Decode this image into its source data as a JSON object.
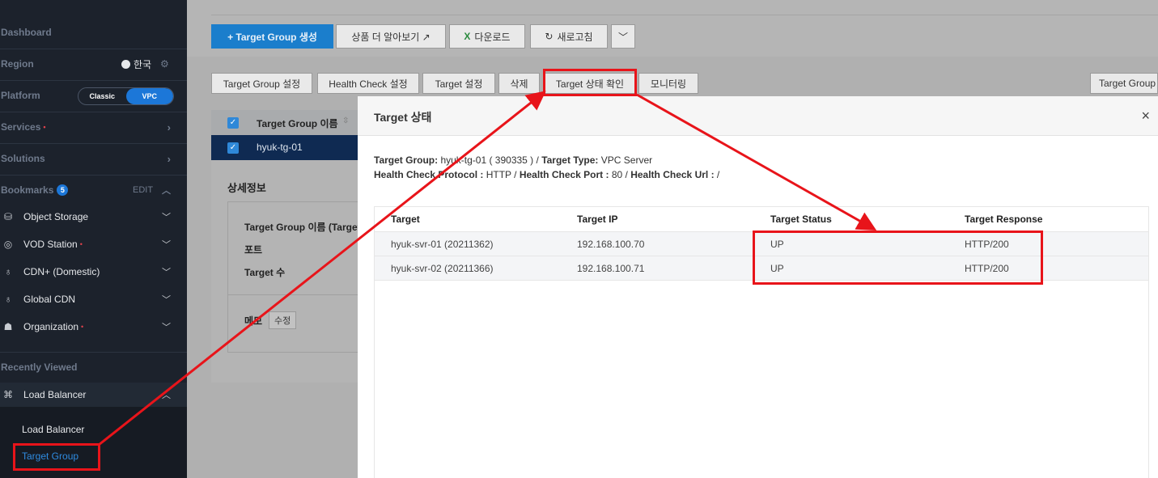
{
  "sidebar": {
    "dashboard": "Dashboard",
    "region": "Region",
    "region_value": "한국",
    "platform": "Platform",
    "platform_options": [
      "Classic",
      "VPC"
    ],
    "services": "Services",
    "solutions": "Solutions",
    "bookmarks": "Bookmarks",
    "bookmarks_count": "5",
    "bookmarks_edit": "EDIT",
    "bookmark_items": [
      "Object Storage",
      "VOD Station",
      "CDN+ (Domestic)",
      "Global CDN",
      "Organization"
    ],
    "recently_viewed": "Recently Viewed",
    "recent_group": "Load Balancer",
    "sub_items": [
      "Load Balancer",
      "Target Group"
    ],
    "required_mark": "•"
  },
  "toolbar": {
    "create": "+ Target Group 생성",
    "learn_more": "상품 더 알아보기 ↗",
    "download": "다운로드",
    "refresh": "새로고침",
    "download_icon": "X"
  },
  "actions": [
    "Target Group 설정",
    "Health Check 설정",
    "Target 설정",
    "삭제",
    "Target 상태 확인",
    "모니터링"
  ],
  "right_button": "Target Group",
  "list": {
    "header": "Target Group 이름",
    "row": "hyuk-tg-01"
  },
  "detail": {
    "title": "상세정보",
    "fields": [
      "Target Group 이름 (TargetG",
      "포트",
      "Target 수"
    ],
    "memo_label": "메모",
    "memo_edit": "수정"
  },
  "modal": {
    "title": "Target 상태",
    "close": "×",
    "tg_label": "Target Group:",
    "tg_value": " hyuk-tg-01 ( 390335 ) / ",
    "tt_label": "Target Type:",
    "tt_value": " VPC Server",
    "hcp_label": "Health Check Protocol :",
    "hcp_value": " HTTP / ",
    "hcport_label": "Health Check Port :",
    "hcport_value": " 80 / ",
    "hcurl_label": "Health Check Url :",
    "hcurl_value": " /",
    "columns": [
      "Target",
      "Target IP",
      "Target Status",
      "Target Response"
    ],
    "rows": [
      {
        "target": "hyuk-svr-01 (20211362)",
        "ip": "192.168.100.70",
        "status": "UP",
        "response": "HTTP/200"
      },
      {
        "target": "hyuk-svr-02 (20211366)",
        "ip": "192.168.100.71",
        "status": "UP",
        "response": "HTTP/200"
      }
    ]
  },
  "colors": {
    "accent": "#1c77d8",
    "highlight": "#e8141a",
    "sidebar": "#1c222c"
  }
}
